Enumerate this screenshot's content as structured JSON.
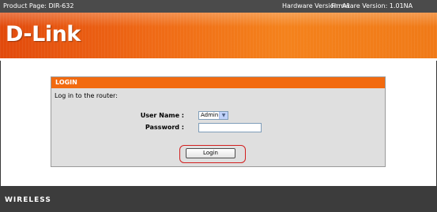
{
  "header": {
    "product_page": "Product Page: DIR-632",
    "hardware_version": "Hardware Version: A1",
    "firmware_version": "Firmware Version: 1.01NA"
  },
  "banner": {
    "logo_text": "D-Link"
  },
  "login": {
    "title": "LOGIN",
    "instruction": "Log in to the router:",
    "username_label": "User Name :",
    "username_value": "Admin",
    "password_label": "Password :",
    "password_value": "",
    "login_button": "Login"
  },
  "footer": {
    "label": "WIRELESS"
  },
  "colors": {
    "accent": "#f26a0f",
    "topbar": "#4b4b4b",
    "footer": "#3c3c3c",
    "highlight": "#d21f1f"
  }
}
